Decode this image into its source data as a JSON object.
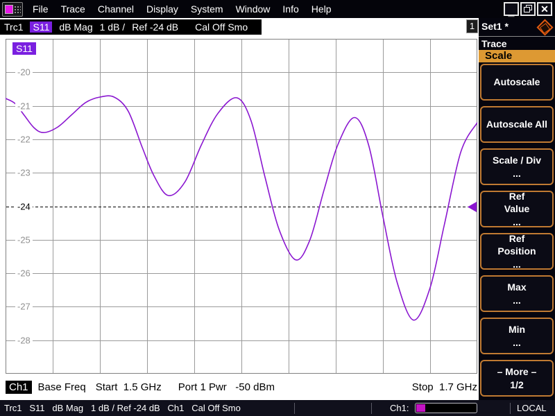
{
  "menu": {
    "items": [
      "File",
      "Trace",
      "Channel",
      "Display",
      "System",
      "Window",
      "Info",
      "Help"
    ]
  },
  "window_controls": {
    "minimize": "_",
    "restore": "restore",
    "close": "✕"
  },
  "trace_bar": {
    "trace": "Trc1",
    "parameter": "S11",
    "format": "dB Mag",
    "scale": "1 dB /",
    "ref": "Ref -24 dB",
    "cal": "Cal Off Smo",
    "window_number": "1"
  },
  "diagram": {
    "trace_label": "S11"
  },
  "channel_bar": {
    "channel": "Ch1",
    "sweep": "Base Freq",
    "start": "Start  1.5 GHz",
    "power": "Port 1 Pwr   -50 dBm",
    "stop": "Stop  1.7 GHz"
  },
  "sidebar": {
    "setup": "Set1 *",
    "logo": "rohde-schwarz-logo",
    "group": "Trace",
    "section": "Scale",
    "buttons": [
      {
        "label": "Autoscale"
      },
      {
        "label": "Autoscale All"
      },
      {
        "label": "Scale / Div\n..."
      },
      {
        "label": "Ref\nValue\n..."
      },
      {
        "label": "Ref\nPosition\n..."
      },
      {
        "label": "Max\n..."
      },
      {
        "label": "Min\n..."
      },
      {
        "label": "– More –\n1/2"
      }
    ]
  },
  "status_bar": {
    "summary": "Trc1   S11   dB Mag   1 dB / Ref -24 dB   Ch1   Cal Off Smo",
    "channel_label": "Ch1:",
    "progress_pct": 15,
    "mode": "LOCAL"
  },
  "colors": {
    "highlight_purple": "#7A1FE0",
    "trace_purple": "#8A16D0",
    "accent_orange": "#C07A32",
    "header_orange": "#DD9933",
    "progress_magenta": "#C313C3",
    "grid_gray": "#9A9A9A"
  },
  "chart_data": {
    "type": "line",
    "title": "S11 reflection magnitude trace",
    "x_unit": "GHz",
    "y_unit": "dB",
    "x_range": [
      1.5,
      1.7
    ],
    "y_range": [
      -29,
      -19
    ],
    "x_divisions": 10,
    "y_ticks": [
      -20,
      -21,
      -22,
      -23,
      -24,
      -25,
      -26,
      -27,
      -28
    ],
    "ref_level": -24,
    "scale_per_div": "1 dB",
    "grid": true,
    "xlabel_start": "Start 1.5 GHz",
    "xlabel_stop": "Stop 1.7 GHz",
    "series": [
      {
        "name": "S11",
        "color": "#8A16D0",
        "x": [
          1.5,
          1.504,
          1.508,
          1.512,
          1.516,
          1.522,
          1.528,
          1.534,
          1.54,
          1.546,
          1.552,
          1.558,
          1.563,
          1.569,
          1.576,
          1.583,
          1.59,
          1.598,
          1.604,
          1.61,
          1.616,
          1.623,
          1.629,
          1.635,
          1.641,
          1.648,
          1.654,
          1.66,
          1.666,
          1.673,
          1.68,
          1.686,
          1.693,
          1.7
        ],
        "y": [
          -20.78,
          -20.93,
          -21.29,
          -21.65,
          -21.8,
          -21.64,
          -21.27,
          -20.9,
          -20.74,
          -20.74,
          -21.16,
          -22.25,
          -23.1,
          -23.68,
          -23.28,
          -22.17,
          -21.23,
          -20.76,
          -21.43,
          -23.13,
          -24.7,
          -25.6,
          -25.01,
          -23.52,
          -22.14,
          -21.35,
          -22.19,
          -24.31,
          -26.27,
          -27.4,
          -26.43,
          -24.56,
          -22.38,
          -21.5
        ]
      }
    ]
  }
}
